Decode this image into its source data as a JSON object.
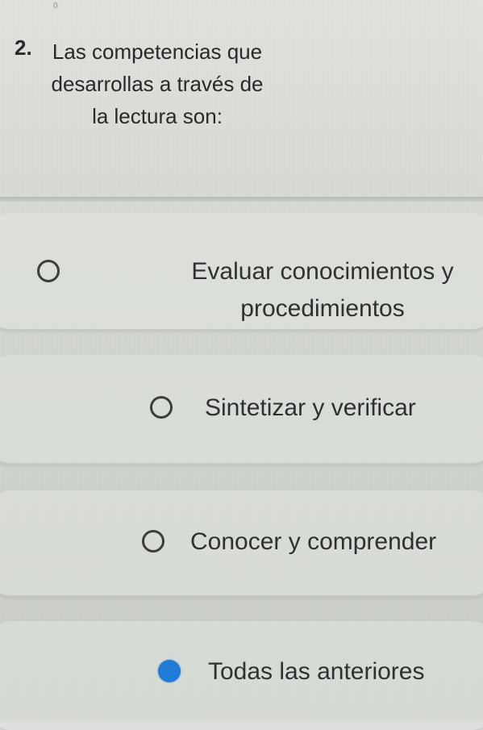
{
  "question": {
    "number": "2.",
    "text": "Las competencias que desarrollas a través de la lectura son:"
  },
  "top_mark": "0",
  "options": [
    {
      "label": "Evaluar conocimientos y procedimientos",
      "selected": false
    },
    {
      "label": "Sintetizar y verificar",
      "selected": false
    },
    {
      "label": "Conocer y comprender",
      "selected": false
    },
    {
      "label": "Todas las anteriores",
      "selected": true
    }
  ],
  "colors": {
    "selected_radio": "#1f7bd6",
    "radio_outline": "#3b3e3c",
    "background": "#d5d8d4",
    "text": "#2b2e2c"
  }
}
